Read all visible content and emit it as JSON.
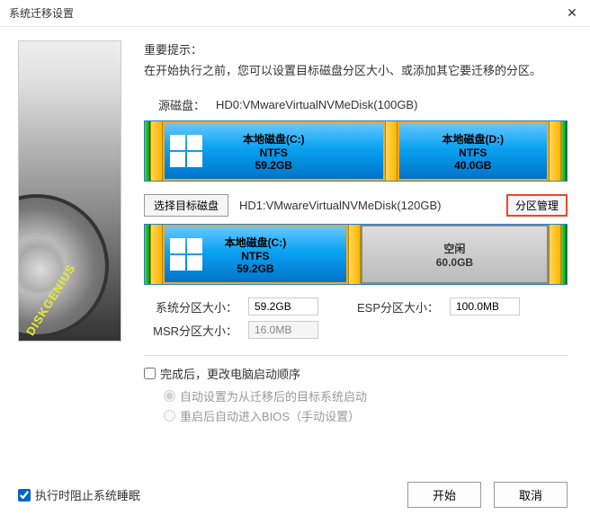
{
  "window": {
    "title": "系统迁移设置"
  },
  "sidebar": {
    "brand": "DISKGENIUS"
  },
  "hint": {
    "title": "重要提示：",
    "text": "在开始执行之前，您可以设置目标磁盘分区大小、或添加其它要迁移的分区。"
  },
  "source": {
    "label": "源磁盘：",
    "path": "HD0:VMwareVirtualNVMeDisk(100GB)",
    "parts": [
      {
        "name": "本地磁盘(C:)",
        "fs": "NTFS",
        "size": "59.2GB",
        "flex": 59,
        "win": true
      },
      {
        "name": "本地磁盘(D:)",
        "fs": "NTFS",
        "size": "40.0GB",
        "flex": 40,
        "win": false
      }
    ]
  },
  "target": {
    "select_btn": "选择目标磁盘",
    "path": "HD1:VMwareVirtualNVMeDisk(120GB)",
    "manage_btn": "分区管理",
    "parts": [
      {
        "name": "本地磁盘(C:)",
        "fs": "NTFS",
        "size": "59.2GB",
        "flex": 59,
        "win": true
      }
    ],
    "free": {
      "label": "空闲",
      "size": "60.0GB",
      "flex": 60
    }
  },
  "fields": {
    "sys_label": "系统分区大小：",
    "sys_val": "59.2GB",
    "esp_label": "ESP分区大小：",
    "esp_val": "100.0MB",
    "msr_label": "MSR分区大小：",
    "msr_val": "16.0MB"
  },
  "options": {
    "boot_change": "完成后，更改电脑启动顺序",
    "auto_boot": "自动设置为从迁移后的目标系统启动",
    "bios_boot": "重启后自动进入BIOS（手动设置）"
  },
  "footer": {
    "prevent_sleep": "执行时阻止系统睡眠",
    "start": "开始",
    "cancel": "取消"
  }
}
